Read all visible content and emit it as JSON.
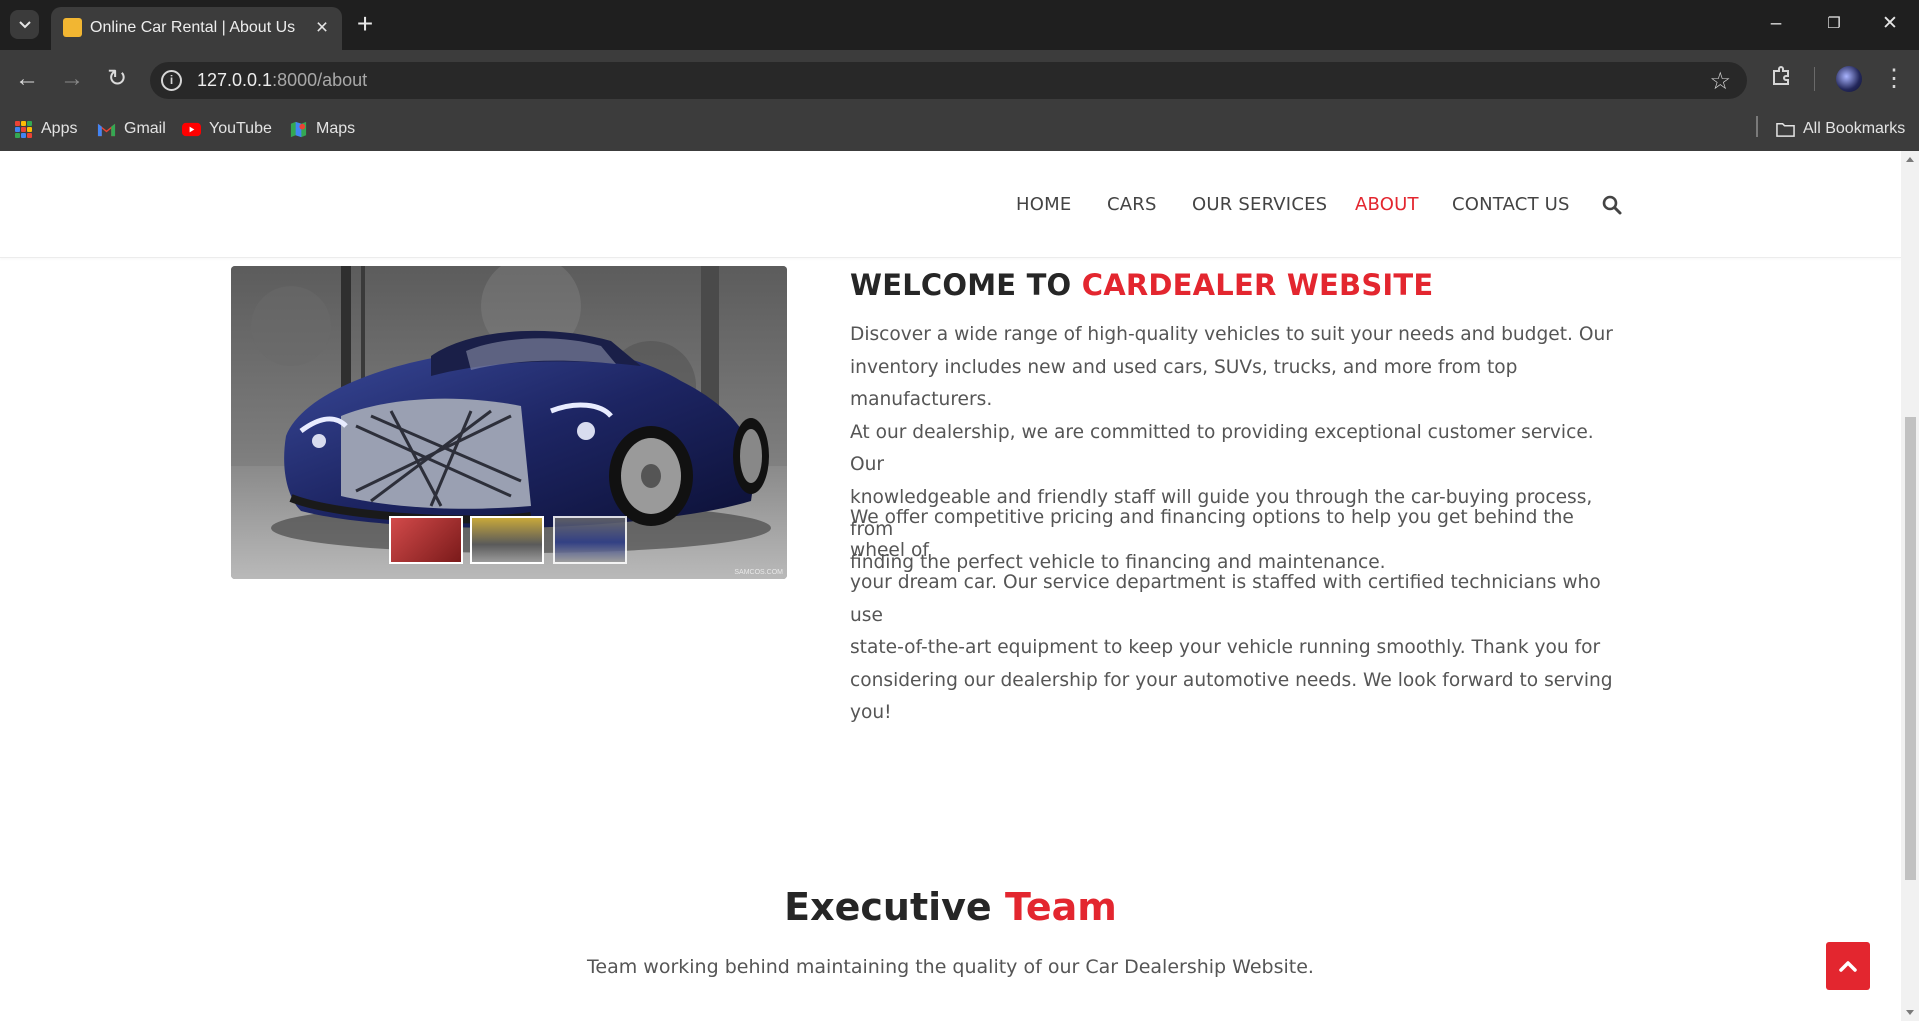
{
  "browser": {
    "tab_title": "Online Car Rental | About Us",
    "url_host": "127.0.0.1",
    "url_rest": ":8000/about",
    "bookmarks": [
      {
        "label": "Apps",
        "icon": "apps-grid-icon"
      },
      {
        "label": "Gmail",
        "icon": "gmail-icon"
      },
      {
        "label": "YouTube",
        "icon": "youtube-icon"
      },
      {
        "label": "Maps",
        "icon": "maps-icon"
      }
    ],
    "all_bookmarks_label": "All Bookmarks"
  },
  "nav": {
    "items": [
      "HOME",
      "CARS",
      "OUR SERVICES",
      "ABOUT",
      "CONTACT US"
    ],
    "active": "ABOUT"
  },
  "about": {
    "heading_prefix": "WELCOME TO ",
    "heading_highlight": "CARDEALER WEBSITE",
    "paragraph1_lines": [
      "Discover a wide range of high-quality vehicles to suit your needs and budget. Our",
      "inventory includes new and used cars, SUVs, trucks, and more from top manufacturers.",
      "At our dealership, we are committed to providing exceptional customer service. Our",
      "knowledgeable and friendly staff will guide you through the car-buying process, from",
      "finding the perfect vehicle to financing and maintenance."
    ],
    "paragraph2_lines": [
      "We offer competitive pricing and financing options to help you get behind the wheel of",
      "your dream car. Our service department is staffed with certified technicians who use",
      "state-of-the-art equipment to keep your vehicle running smoothly. Thank you for",
      "considering our dealership for your automotive needs. We look forward to serving you!"
    ],
    "image_watermark": "SAMCOS.COM"
  },
  "team": {
    "title_prefix": "Executive ",
    "title_highlight": "Team",
    "subtitle": "Team working behind maintaining the quality of our Car Dealership Website."
  },
  "colors": {
    "accent": "#e3262f",
    "heading": "#262626",
    "body_text": "#555555"
  }
}
